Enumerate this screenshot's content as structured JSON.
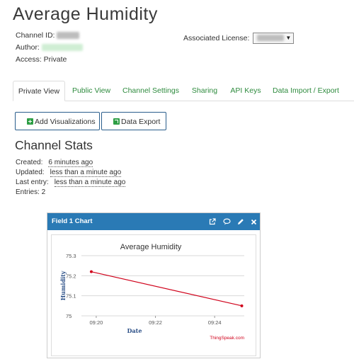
{
  "page": {
    "title": "Average Humidity",
    "channel_id_label": "Channel ID:",
    "author_label": "Author:",
    "access": "Access: Private",
    "license_label": "Associated License:"
  },
  "tabs": [
    {
      "label": "Private View"
    },
    {
      "label": "Public View"
    },
    {
      "label": "Channel Settings"
    },
    {
      "label": "Sharing"
    },
    {
      "label": "API Keys"
    },
    {
      "label": "Data Import / Export"
    }
  ],
  "buttons": {
    "add_visualizations": "Add Visualizations",
    "data_export": "Data Export"
  },
  "stats": {
    "heading": "Channel Stats",
    "created_label": "Created:",
    "created_value": "6 minutes ago",
    "updated_label": "Updated:",
    "updated_value": "less than a minute ago",
    "last_entry_label": "Last entry:",
    "last_entry_value": "less than a minute ago",
    "entries": "Entries: 2"
  },
  "chart_panel": {
    "header": "Field 1 Chart",
    "icons": [
      "external-link-icon",
      "comment-icon",
      "pencil-icon",
      "close-icon"
    ]
  },
  "chart_data": {
    "type": "line",
    "title": "Average Humidity",
    "xlabel": "Date",
    "ylabel": "Humidity",
    "credit": "ThingSpeak.com",
    "x_ticks": [
      "09:20",
      "09:22",
      "09:24"
    ],
    "y_ticks": [
      75,
      75.1,
      75.2,
      75.3
    ],
    "ylim": [
      75,
      75.3
    ],
    "xlim": [
      "09:19:30",
      "09:25:00"
    ],
    "series": [
      {
        "color": "#d0021b",
        "points": [
          {
            "x": "09:19:50",
            "y": 75.22
          },
          {
            "x": "09:24:55",
            "y": 75.05
          }
        ]
      }
    ],
    "grid": true
  }
}
